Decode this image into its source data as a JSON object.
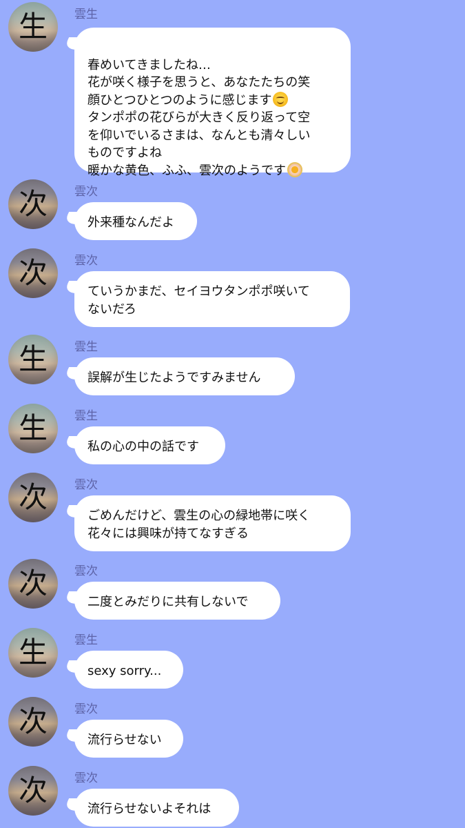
{
  "messages": [
    {
      "sender": "雲生",
      "avatar_char": "生",
      "text": "春めいてきましたね…\n花が咲く様子を思うと、あなたたちの笑\n顔ひとつひとつのように感じます",
      "text2": "\nタンポポの花びらが大きく反り返って空\nを仰いでいるさまは、なんとも清々しい\nものですよね\n暖かな黄色、ふふ、雲次のようです",
      "emoji": [
        "smiling-face-icon",
        "blossom-icon"
      ]
    },
    {
      "sender": "雲次",
      "avatar_char": "次",
      "text": "外来種なんだよ"
    },
    {
      "sender": "雲次",
      "avatar_char": "次",
      "text": "ていうかまだ、セイヨウタンポポ咲いて\nないだろ"
    },
    {
      "sender": "雲生",
      "avatar_char": "生",
      "text": "誤解が生じたようですみません"
    },
    {
      "sender": "雲生",
      "avatar_char": "生",
      "text": "私の心の中の話です"
    },
    {
      "sender": "雲次",
      "avatar_char": "次",
      "text": "ごめんだけど、雲生の心の緑地帯に咲く\n花々には興味が持てなすぎる"
    },
    {
      "sender": "雲次",
      "avatar_char": "次",
      "text": "二度とみだりに共有しないで"
    },
    {
      "sender": "雲生",
      "avatar_char": "生",
      "text": "sexy sorry..."
    },
    {
      "sender": "雲次",
      "avatar_char": "次",
      "text": "流行らせない"
    },
    {
      "sender": "雲次",
      "avatar_char": "次",
      "text": "流行らせないよそれは"
    }
  ],
  "colors": {
    "background": "#98acfc",
    "bubble": "#ffffff",
    "sender_name": "#5d63a7"
  }
}
